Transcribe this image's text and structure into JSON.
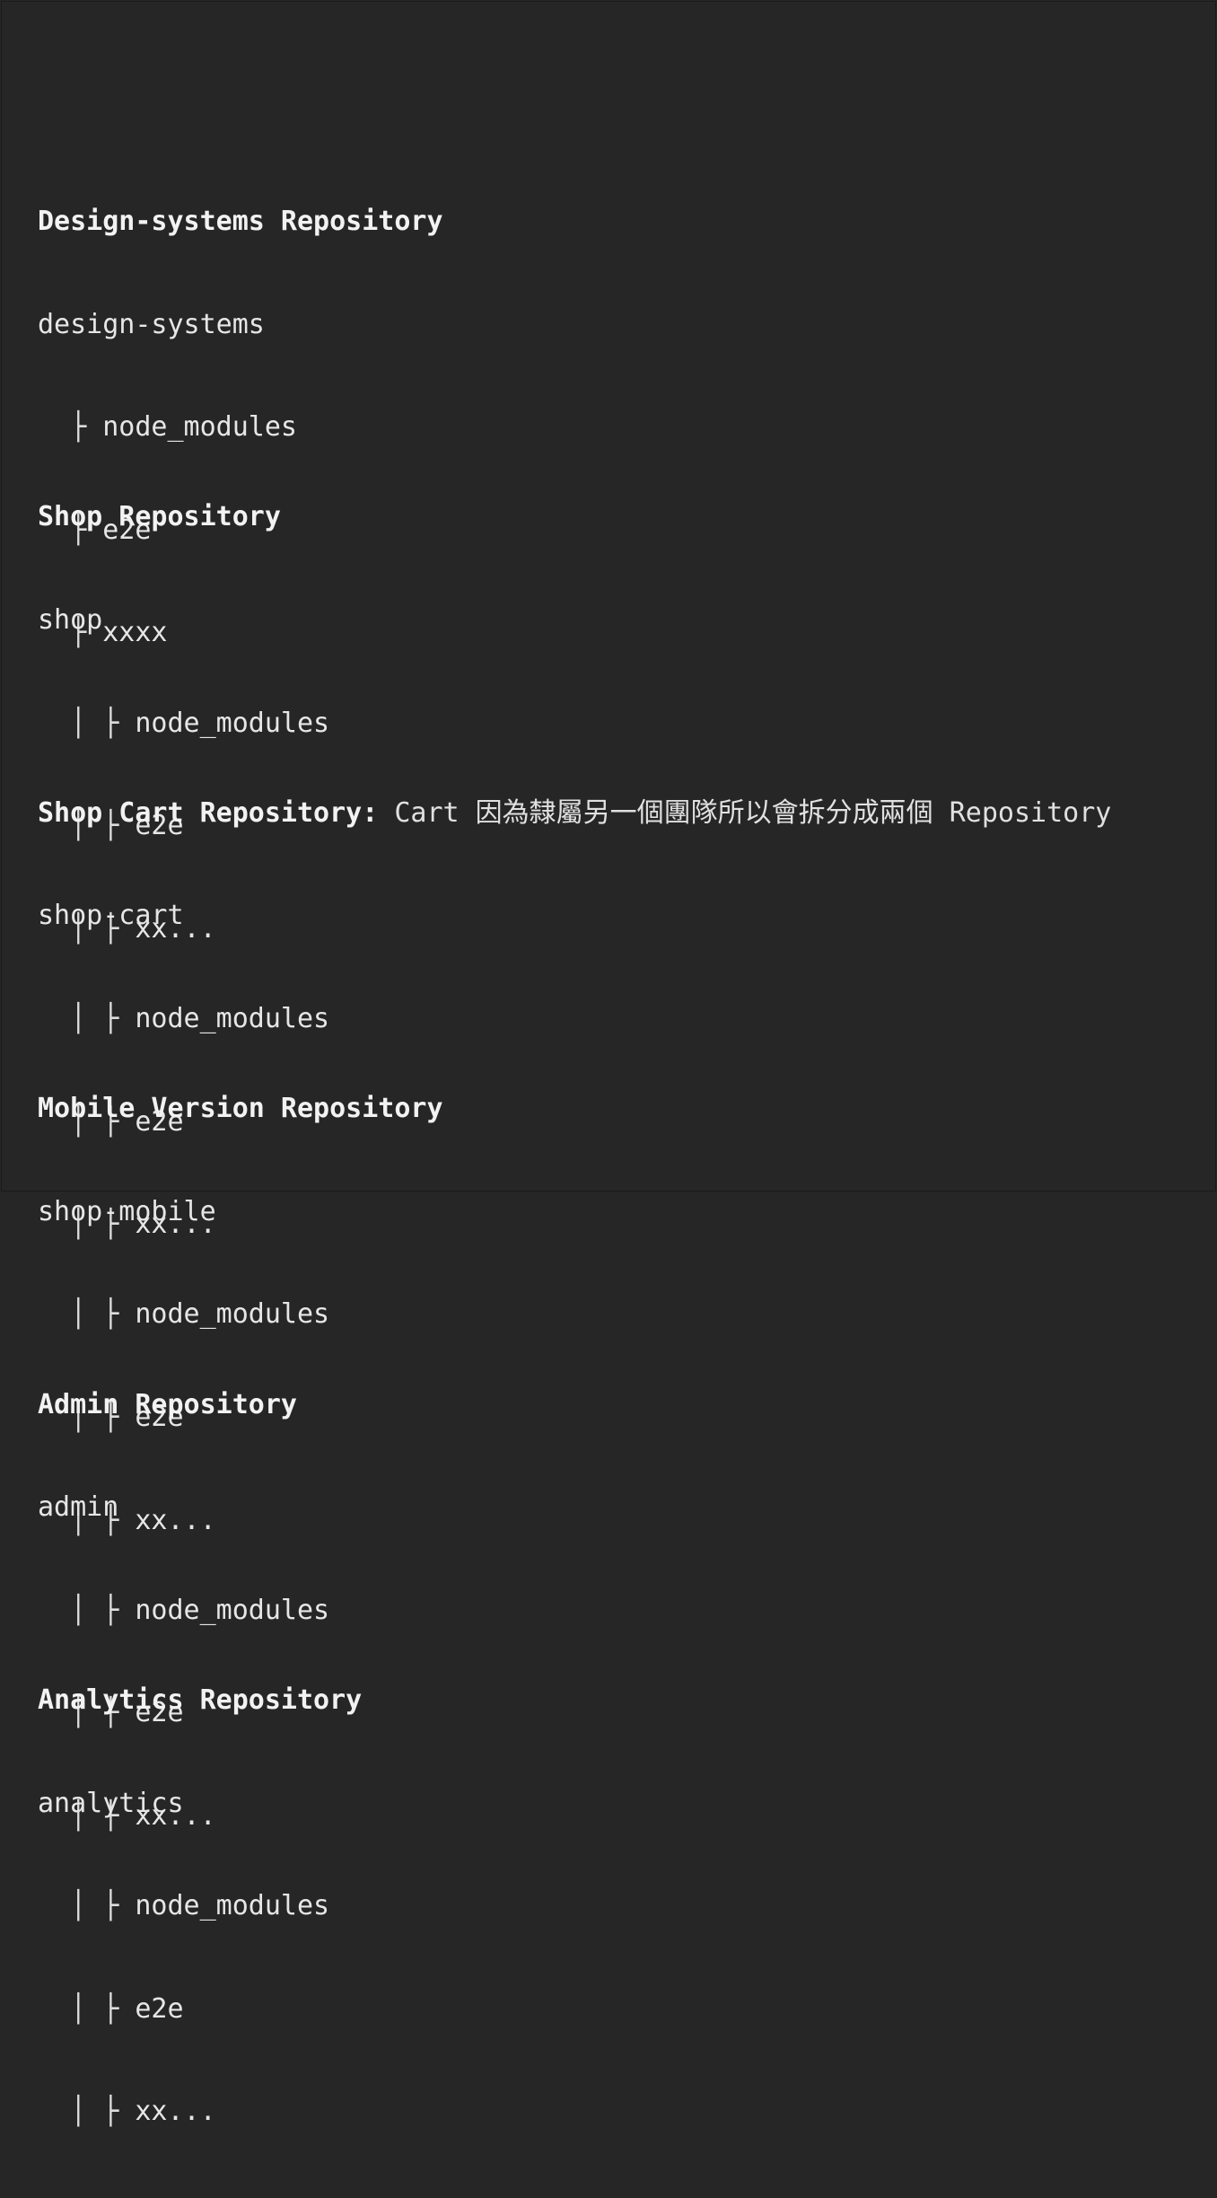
{
  "sections": [
    {
      "title": "Design-systems Repository",
      "note": "",
      "folder": "design-systems",
      "prefix": "  ├ ",
      "items": [
        "node_modules",
        "e2e",
        "xxxx"
      ]
    },
    {
      "title": "Shop Repository",
      "note": "",
      "folder": "shop",
      "prefix": "  │ ├ ",
      "items": [
        "node_modules",
        "e2e",
        "xx..."
      ]
    },
    {
      "title": "Shop Cart Repository:",
      "note": " Cart 因為隸屬另一個團隊所以會拆分成兩個 Repository",
      "folder": "shop-cart",
      "prefix": "  │ ├ ",
      "items": [
        "node_modules",
        "e2e",
        "xx..."
      ]
    },
    {
      "title": "Mobile Version Repository",
      "note": "",
      "folder": "shop-mobile",
      "prefix": "  │ ├ ",
      "items": [
        "node_modules",
        "e2e",
        "xx..."
      ]
    },
    {
      "title": "Admin Repository",
      "note": "",
      "folder": "admin",
      "prefix": "  │ ├ ",
      "items": [
        "node_modules",
        "e2e",
        "xx..."
      ]
    },
    {
      "title": "Analytics Repository",
      "note": "",
      "folder": "analytics",
      "prefix": "  │ ├ ",
      "items": [
        "node_modules",
        "e2e",
        "xx..."
      ]
    }
  ],
  "colors": {
    "background": "#262626",
    "text": "#e6e6e6"
  }
}
